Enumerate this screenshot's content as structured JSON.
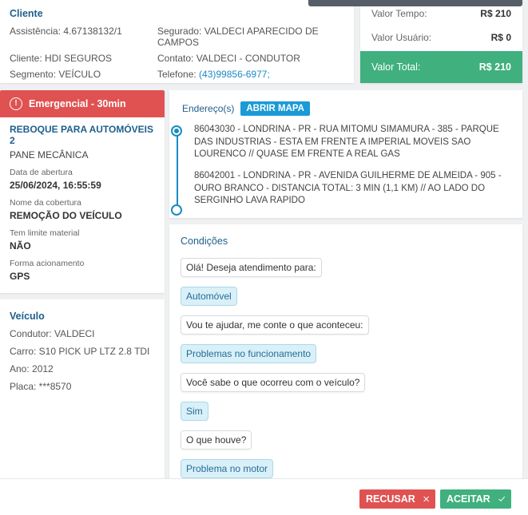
{
  "cliente": {
    "title": "Cliente",
    "assistencia": "Assistência: 4.67138132/1",
    "segurado": "Segurado: VALDECI APARECIDO DE CAMPOS",
    "cliente": "Cliente: HDI SEGUROS",
    "contato": "Contato: VALDECI - CONDUTOR",
    "segmento": "Segmento: VEÍCULO",
    "telefone_label": "Telefone:",
    "telefone": "(43)99856-6977;"
  },
  "valores": {
    "tempo_label": "Valor Tempo:",
    "tempo_value": "R$ 210",
    "usuario_label": "Valor Usuário:",
    "usuario_value": "R$ 0",
    "total_label": "Valor Total:",
    "total_value": "R$ 210"
  },
  "servico": {
    "badge": "Emergencial - 30min",
    "title": "REBOQUE PARA AUTOMÓVEIS 2",
    "subtitle": "PANE MECÂNICA",
    "data_label": "Data de abertura",
    "data_value": "25/06/2024, 16:55:59",
    "cobertura_label": "Nome da cobertura",
    "cobertura_value": "REMOÇÃO DO VEÍCULO",
    "limite_label": "Tem limite material",
    "limite_value": "NÃO",
    "forma_label": "Forma acionamento",
    "forma_value": "GPS"
  },
  "veiculo": {
    "title": "Veículo",
    "condutor": "Condutor: VALDECI",
    "carro": "Carro: S10 PICK UP LTZ 2.8 TDI",
    "ano": "Ano: 2012",
    "placa": "Placa: ***8570"
  },
  "endereco": {
    "label": "Endereço(s)",
    "map_button": "ABRIR MAPA",
    "origem": "86043030 - LONDRINA - PR - RUA MITOMU SIMAMURA - 385 - PARQUE DAS INDUSTRIAS - ESTA EM FRENTE A IMPERIAL MOVEIS SAO LOURENCO // QUASE EM FRENTE A REAL GAS",
    "destino": "86042001 - LONDRINA - PR - AVENIDA GUILHERME DE ALMEIDA - 905 - OURO BRANCO - DISTANCIA TOTAL: 3 MIN (1,1 KM) // AO LADO DO SERGINHO LAVA RAPIDO"
  },
  "condicoes": {
    "title": "Condições",
    "messages": [
      {
        "type": "q",
        "text": "Olá! Deseja atendimento para:"
      },
      {
        "type": "a",
        "text": "Automóvel"
      },
      {
        "type": "q",
        "text": "Vou te ajudar, me conte o que aconteceu:"
      },
      {
        "type": "a",
        "text": "Problemas no funcionamento"
      },
      {
        "type": "q",
        "text": "Você sabe o que ocorreu com o veículo?"
      },
      {
        "type": "a",
        "text": "Sim"
      },
      {
        "type": "q",
        "text": "O que houve?"
      },
      {
        "type": "a",
        "text": "Problema no motor"
      }
    ]
  },
  "footer": {
    "recusar": "RECUSAR",
    "aceitar": "ACEITAR"
  }
}
